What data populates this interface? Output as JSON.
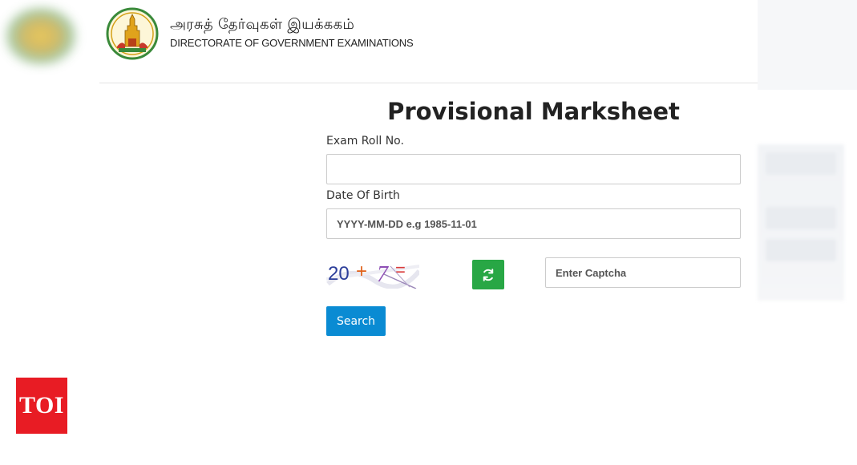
{
  "header": {
    "tamil_title": "அரசுத் தேர்வுகள் இயக்ககம்",
    "english_title": "DIRECTORATE OF GOVERNMENT EXAMINATIONS"
  },
  "form": {
    "title": "Provisional Marksheet",
    "roll_label": "Exam Roll No.",
    "roll_value": "",
    "dob_label": "Date Of Birth",
    "dob_placeholder": "YYYY-MM-DD e.g 1985-11-01",
    "captcha_text": "20 + 7 =",
    "captcha_placeholder": "Enter Captcha",
    "search_label": "Search"
  },
  "badge": {
    "text": "TOI",
    "color": "#e81c24"
  },
  "colors": {
    "refresh_button": "#28a745",
    "search_button": "#0a8bd3"
  }
}
